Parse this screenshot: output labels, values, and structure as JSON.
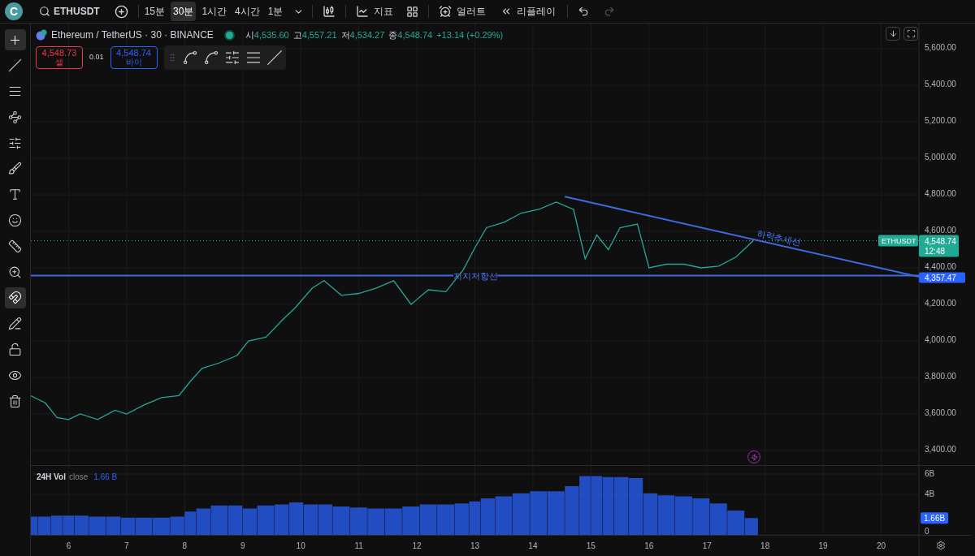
{
  "top_bar": {
    "logo": "C",
    "symbol": "ETHUSDT",
    "intervals": [
      {
        "label": "15분",
        "selected": false
      },
      {
        "label": "30분",
        "selected": true
      },
      {
        "label": "1시간",
        "selected": false
      },
      {
        "label": "4시간",
        "selected": false
      },
      {
        "label": "1분",
        "selected": false
      }
    ],
    "indicators": "지표",
    "alert": "얼러트",
    "replay": "리플레이"
  },
  "left_toolbar": [
    {
      "kind": "crosshair",
      "selected": true
    },
    {
      "kind": "trend_line",
      "selected": false
    },
    {
      "kind": "fib",
      "selected": false
    },
    {
      "kind": "pattern",
      "selected": false
    },
    {
      "kind": "forecast",
      "selected": false
    },
    {
      "kind": "brush",
      "selected": false
    },
    {
      "kind": "text",
      "selected": false
    },
    {
      "kind": "emoji",
      "selected": false
    },
    {
      "kind": "ruler",
      "selected": false
    },
    {
      "kind": "zoom",
      "selected": false
    },
    {
      "kind": "magnet",
      "selected": true
    },
    {
      "kind": "draw_lock",
      "selected": false
    },
    {
      "kind": "lock",
      "selected": false
    },
    {
      "kind": "eye",
      "selected": false
    },
    {
      "kind": "trash",
      "selected": false
    }
  ],
  "legend": {
    "title": "Ethereum / TetherUS · 30 · BINANCE",
    "ohlc": [
      {
        "label": "시",
        "value": "4,535.60"
      },
      {
        "label": "고",
        "value": "4,557.21"
      },
      {
        "label": "저",
        "value": "4,534.27"
      },
      {
        "label": "종",
        "value": "4,548.74"
      }
    ],
    "change": "+13.14 (+0.29%)",
    "sell": {
      "price": "4,548.73",
      "label": "셀"
    },
    "spread": "0.01",
    "buy": {
      "price": "4,548.74",
      "label": "바이"
    }
  },
  "price_chart": {
    "drawings": [
      {
        "kind": "trendline",
        "label": "하락추세선"
      },
      {
        "kind": "horizontal",
        "label": "지지저항선",
        "tag": "4,357.47"
      }
    ],
    "price_tag": {
      "price": "4,548.74",
      "countdown": "12:48"
    },
    "chart_data": {
      "type": "line",
      "x": [
        5.35,
        5.6,
        5.8,
        6.0,
        6.2,
        6.5,
        6.8,
        7.0,
        7.3,
        7.6,
        7.9,
        8.1,
        8.3,
        8.6,
        8.9,
        9.1,
        9.4,
        9.7,
        9.9,
        10.2,
        10.4,
        10.7,
        11.0,
        11.3,
        11.6,
        11.9,
        12.2,
        12.5,
        12.8,
        13.0,
        13.2,
        13.5,
        13.8,
        14.1,
        14.4,
        14.7,
        14.9,
        15.1,
        15.3,
        15.5,
        15.8,
        16.0,
        16.3,
        16.6,
        16.9,
        17.2,
        17.5,
        17.8
      ],
      "series": [
        {
          "name": "ETHUSDT",
          "color": "#26a69a",
          "values": [
            3700,
            3660,
            3580,
            3570,
            3600,
            3570,
            3620,
            3600,
            3650,
            3690,
            3700,
            3780,
            3850,
            3880,
            3920,
            4000,
            4020,
            4120,
            4180,
            4290,
            4330,
            4250,
            4260,
            4290,
            4330,
            4200,
            4280,
            4270,
            4390,
            4510,
            4620,
            4650,
            4700,
            4720,
            4760,
            4720,
            4450,
            4580,
            4500,
            4620,
            4640,
            4400,
            4420,
            4420,
            4400,
            4410,
            4460,
            4550
          ]
        }
      ],
      "xlim": [
        5.35,
        21.56
      ],
      "ylim": [
        3320,
        5738
      ],
      "grid": true,
      "yticks": [
        {
          "value": 5600,
          "label": "5,600.00"
        },
        {
          "value": 5400,
          "label": "5,400.00"
        },
        {
          "value": 5200,
          "label": "5,200.00"
        },
        {
          "value": 5000,
          "label": "5,000.00"
        },
        {
          "value": 4800,
          "label": "4,800.00"
        },
        {
          "value": 4600,
          "label": "4,600.00"
        },
        {
          "value": 4400,
          "label": "4,400.00"
        },
        {
          "value": 4200,
          "label": "4,200.00"
        },
        {
          "value": 4000,
          "label": "4,000.00"
        },
        {
          "value": 3800,
          "label": "3,800.00"
        },
        {
          "value": 3600,
          "label": "3,600.00"
        },
        {
          "value": 3400,
          "label": "3,400.00"
        }
      ]
    }
  },
  "volume": {
    "source": "close",
    "value": "1.66 B",
    "tag": "1.66B",
    "chart_data": {
      "type": "bar",
      "x": [
        5.35,
        5.6,
        5.8,
        6.0,
        6.2,
        6.5,
        6.8,
        7.0,
        7.3,
        7.6,
        7.9,
        8.1,
        8.3,
        8.6,
        8.9,
        9.1,
        9.4,
        9.7,
        9.9,
        10.2,
        10.4,
        10.7,
        11.0,
        11.3,
        11.6,
        11.9,
        12.2,
        12.5,
        12.8,
        13.0,
        13.2,
        13.5,
        13.8,
        14.1,
        14.4,
        14.7,
        14.9,
        15.1,
        15.3,
        15.5,
        15.8,
        16.0,
        16.3,
        16.6,
        16.9,
        17.2,
        17.5,
        17.8
      ],
      "series": [
        {
          "name": "24H Vol",
          "color": "#2962ff",
          "values": [
            1.8,
            1.8,
            1.9,
            1.9,
            1.9,
            1.8,
            1.8,
            1.7,
            1.7,
            1.7,
            1.8,
            2.3,
            2.6,
            2.9,
            2.9,
            2.6,
            2.9,
            3.0,
            3.2,
            3.0,
            3.0,
            2.8,
            2.7,
            2.6,
            2.6,
            2.8,
            3.0,
            3.0,
            3.1,
            3.3,
            3.6,
            3.8,
            4.1,
            4.3,
            4.3,
            4.8,
            5.8,
            5.8,
            5.7,
            5.7,
            5.6,
            4.1,
            3.9,
            3.8,
            3.6,
            3.1,
            2.4,
            1.66
          ]
        }
      ],
      "xlim": [
        5.35,
        21.56
      ],
      "ylim": [
        0,
        6.8
      ],
      "grid": true,
      "xticks": [
        {
          "value": 6,
          "label": "6"
        },
        {
          "value": 7,
          "label": "7"
        },
        {
          "value": 8,
          "label": "8"
        },
        {
          "value": 9,
          "label": "9"
        },
        {
          "value": 10,
          "label": "10"
        },
        {
          "value": 11,
          "label": "11"
        },
        {
          "value": 12,
          "label": "12"
        },
        {
          "value": 13,
          "label": "13"
        },
        {
          "value": 14,
          "label": "14"
        },
        {
          "value": 15,
          "label": "15"
        },
        {
          "value": 16,
          "label": "16"
        },
        {
          "value": 17,
          "label": "17"
        },
        {
          "value": 18,
          "label": "18"
        },
        {
          "value": 19,
          "label": "19"
        },
        {
          "value": 20,
          "label": "20"
        }
      ],
      "yticks": [
        {
          "value": 0,
          "label": "0"
        },
        {
          "value": 4,
          "label": "4B"
        },
        {
          "value": 6,
          "label": "6B"
        }
      ]
    }
  }
}
